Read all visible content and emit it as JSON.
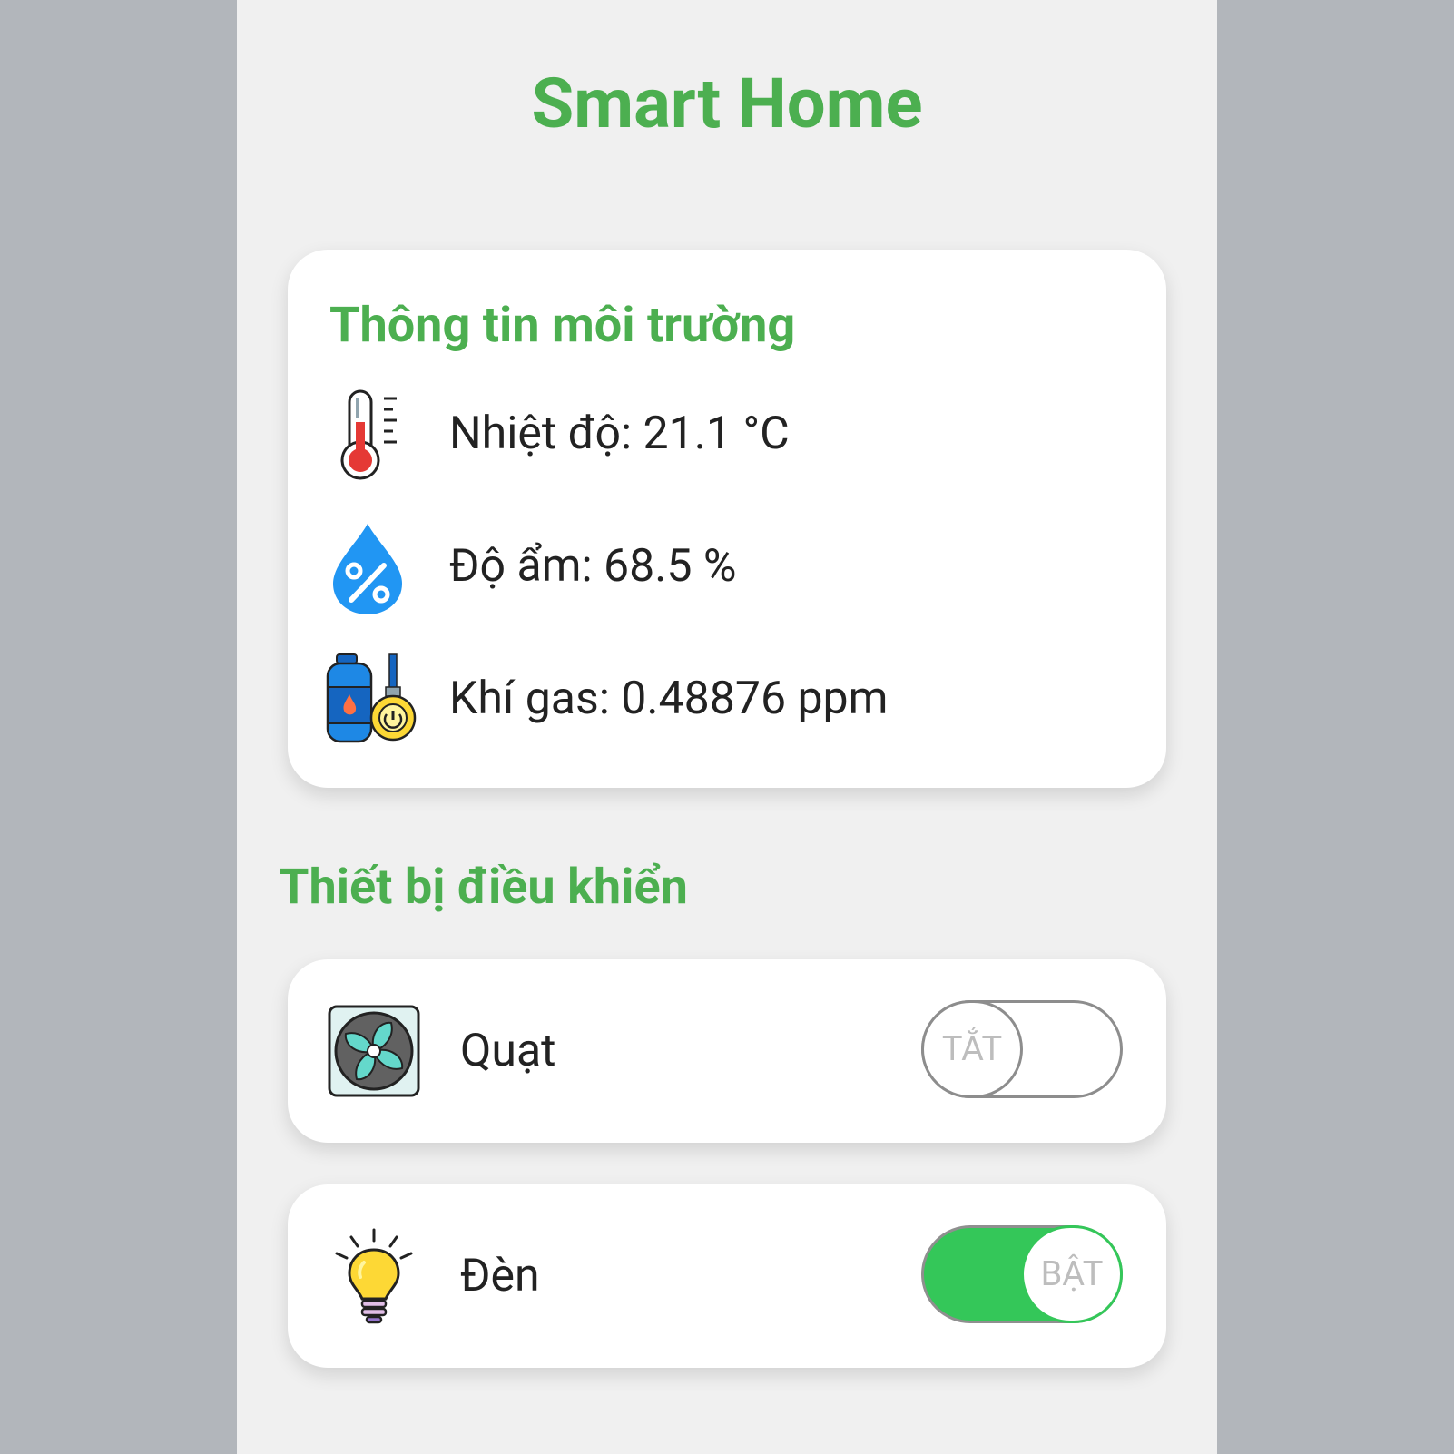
{
  "app": {
    "title": "Smart Home"
  },
  "environment": {
    "heading": "Thông tin môi trường",
    "sensors": [
      {
        "icon": "thermometer-icon",
        "label": "Nhiệt độ: 21.1 °C"
      },
      {
        "icon": "humidity-drop-icon",
        "label": "Độ ẩm: 68.5 %"
      },
      {
        "icon": "gas-cylinder-icon",
        "label": "Khí gas: 0.48876 ppm"
      }
    ]
  },
  "devices": {
    "heading": "Thiết bị điều khiển",
    "items": [
      {
        "icon": "fan-icon",
        "label": "Quạt",
        "state": "off",
        "toggle_text": "TẮT"
      },
      {
        "icon": "light-bulb-icon",
        "label": "Đèn",
        "state": "on",
        "toggle_text": "BẬT"
      }
    ]
  },
  "colors": {
    "accent": "#4caf50",
    "toggle_on": "#34c759",
    "background": "#f0f0f0",
    "outer_background": "#b2b6bb"
  }
}
